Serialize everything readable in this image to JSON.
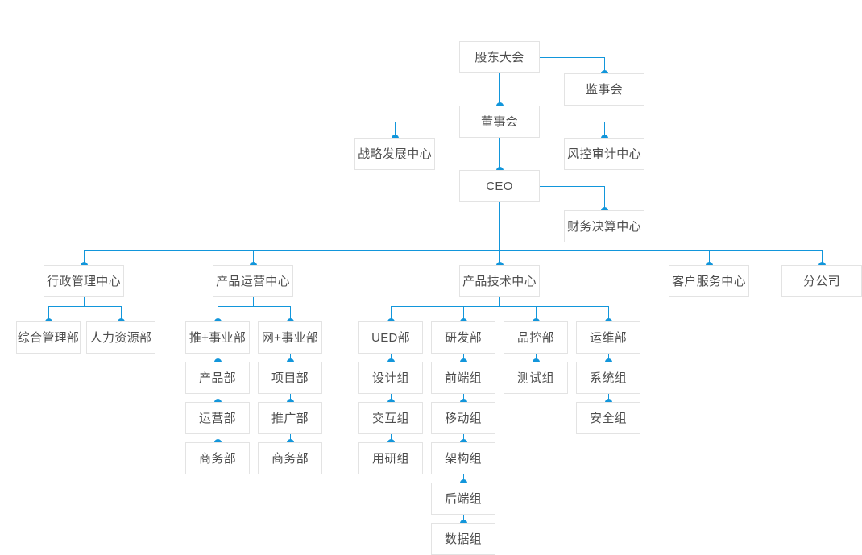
{
  "chart_title": "",
  "theme": {
    "line_color": "#1296db",
    "dot_color": "#1296db",
    "box_border": "#e3e3e3",
    "box_background": "#ffffff",
    "text_color": "#4d4d4d",
    "page_background": "#ffffff"
  },
  "nodes": {
    "shareholders_meeting": "股东大会",
    "board_of_supervisors": "监事会",
    "board_of_directors": "董事会",
    "strategy_development_center": "战略发展中心",
    "risk_control_audit_center": "风控审计中心",
    "ceo": "CEO",
    "finance_settlement_center": "财务决算中心",
    "admin_management_center": "行政管理中心",
    "product_operation_center": "产品运营中心",
    "product_technology_center": "产品技术中心",
    "customer_service_center": "客户服务中心",
    "branch_company": "分公司",
    "general_management_dept": "综合管理部",
    "human_resources_dept": "人力资源部",
    "tui_plus_business_unit": "推+事业部",
    "wang_plus_business_unit": "网+事业部",
    "product_dept": "产品部",
    "project_dept": "项目部",
    "operation_dept": "运营部",
    "promotion_dept": "推广部",
    "business_dept_left": "商务部",
    "business_dept_right": "商务部",
    "ued_dept": "UED部",
    "rd_dept": "研发部",
    "quality_control_dept": "品控部",
    "operation_maintenance_dept": "运维部",
    "design_group": "设计组",
    "frontend_group": "前端组",
    "test_group": "测试组",
    "system_group": "系统组",
    "interaction_group": "交互组",
    "mobile_group": "移动组",
    "security_group": "安全组",
    "user_research_group": "用研组",
    "architecture_group": "架构组",
    "backend_group": "后端组",
    "data_group": "数据组"
  },
  "hierarchy": {
    "root": "股东大会",
    "levels": [
      {
        "level": 0,
        "items": [
          "股东大会"
        ]
      },
      {
        "level": 1,
        "items": [
          "监事会",
          "董事会"
        ]
      },
      {
        "level": 2,
        "items": [
          "战略发展中心",
          "风控审计中心",
          "CEO"
        ]
      },
      {
        "level": 3,
        "items": [
          "财务决算中心",
          "行政管理中心",
          "产品运营中心",
          "产品技术中心",
          "客户服务中心",
          "分公司"
        ]
      },
      {
        "level": 4,
        "items": [
          "综合管理部",
          "人力资源部",
          "推+事业部",
          "网+事业部",
          "UED部",
          "研发部",
          "品控部",
          "运维部"
        ]
      },
      {
        "level": 5,
        "items": [
          "产品部",
          "项目部",
          "设计组",
          "前端组",
          "测试组",
          "系统组"
        ]
      },
      {
        "level": 6,
        "items": [
          "运营部",
          "推广部",
          "交互组",
          "移动组",
          "安全组"
        ]
      },
      {
        "level": 7,
        "items": [
          "商务部",
          "商务部",
          "用研组",
          "架构组"
        ]
      },
      {
        "level": 8,
        "items": [
          "后端组"
        ]
      },
      {
        "level": 9,
        "items": [
          "数据组"
        ]
      }
    ]
  }
}
